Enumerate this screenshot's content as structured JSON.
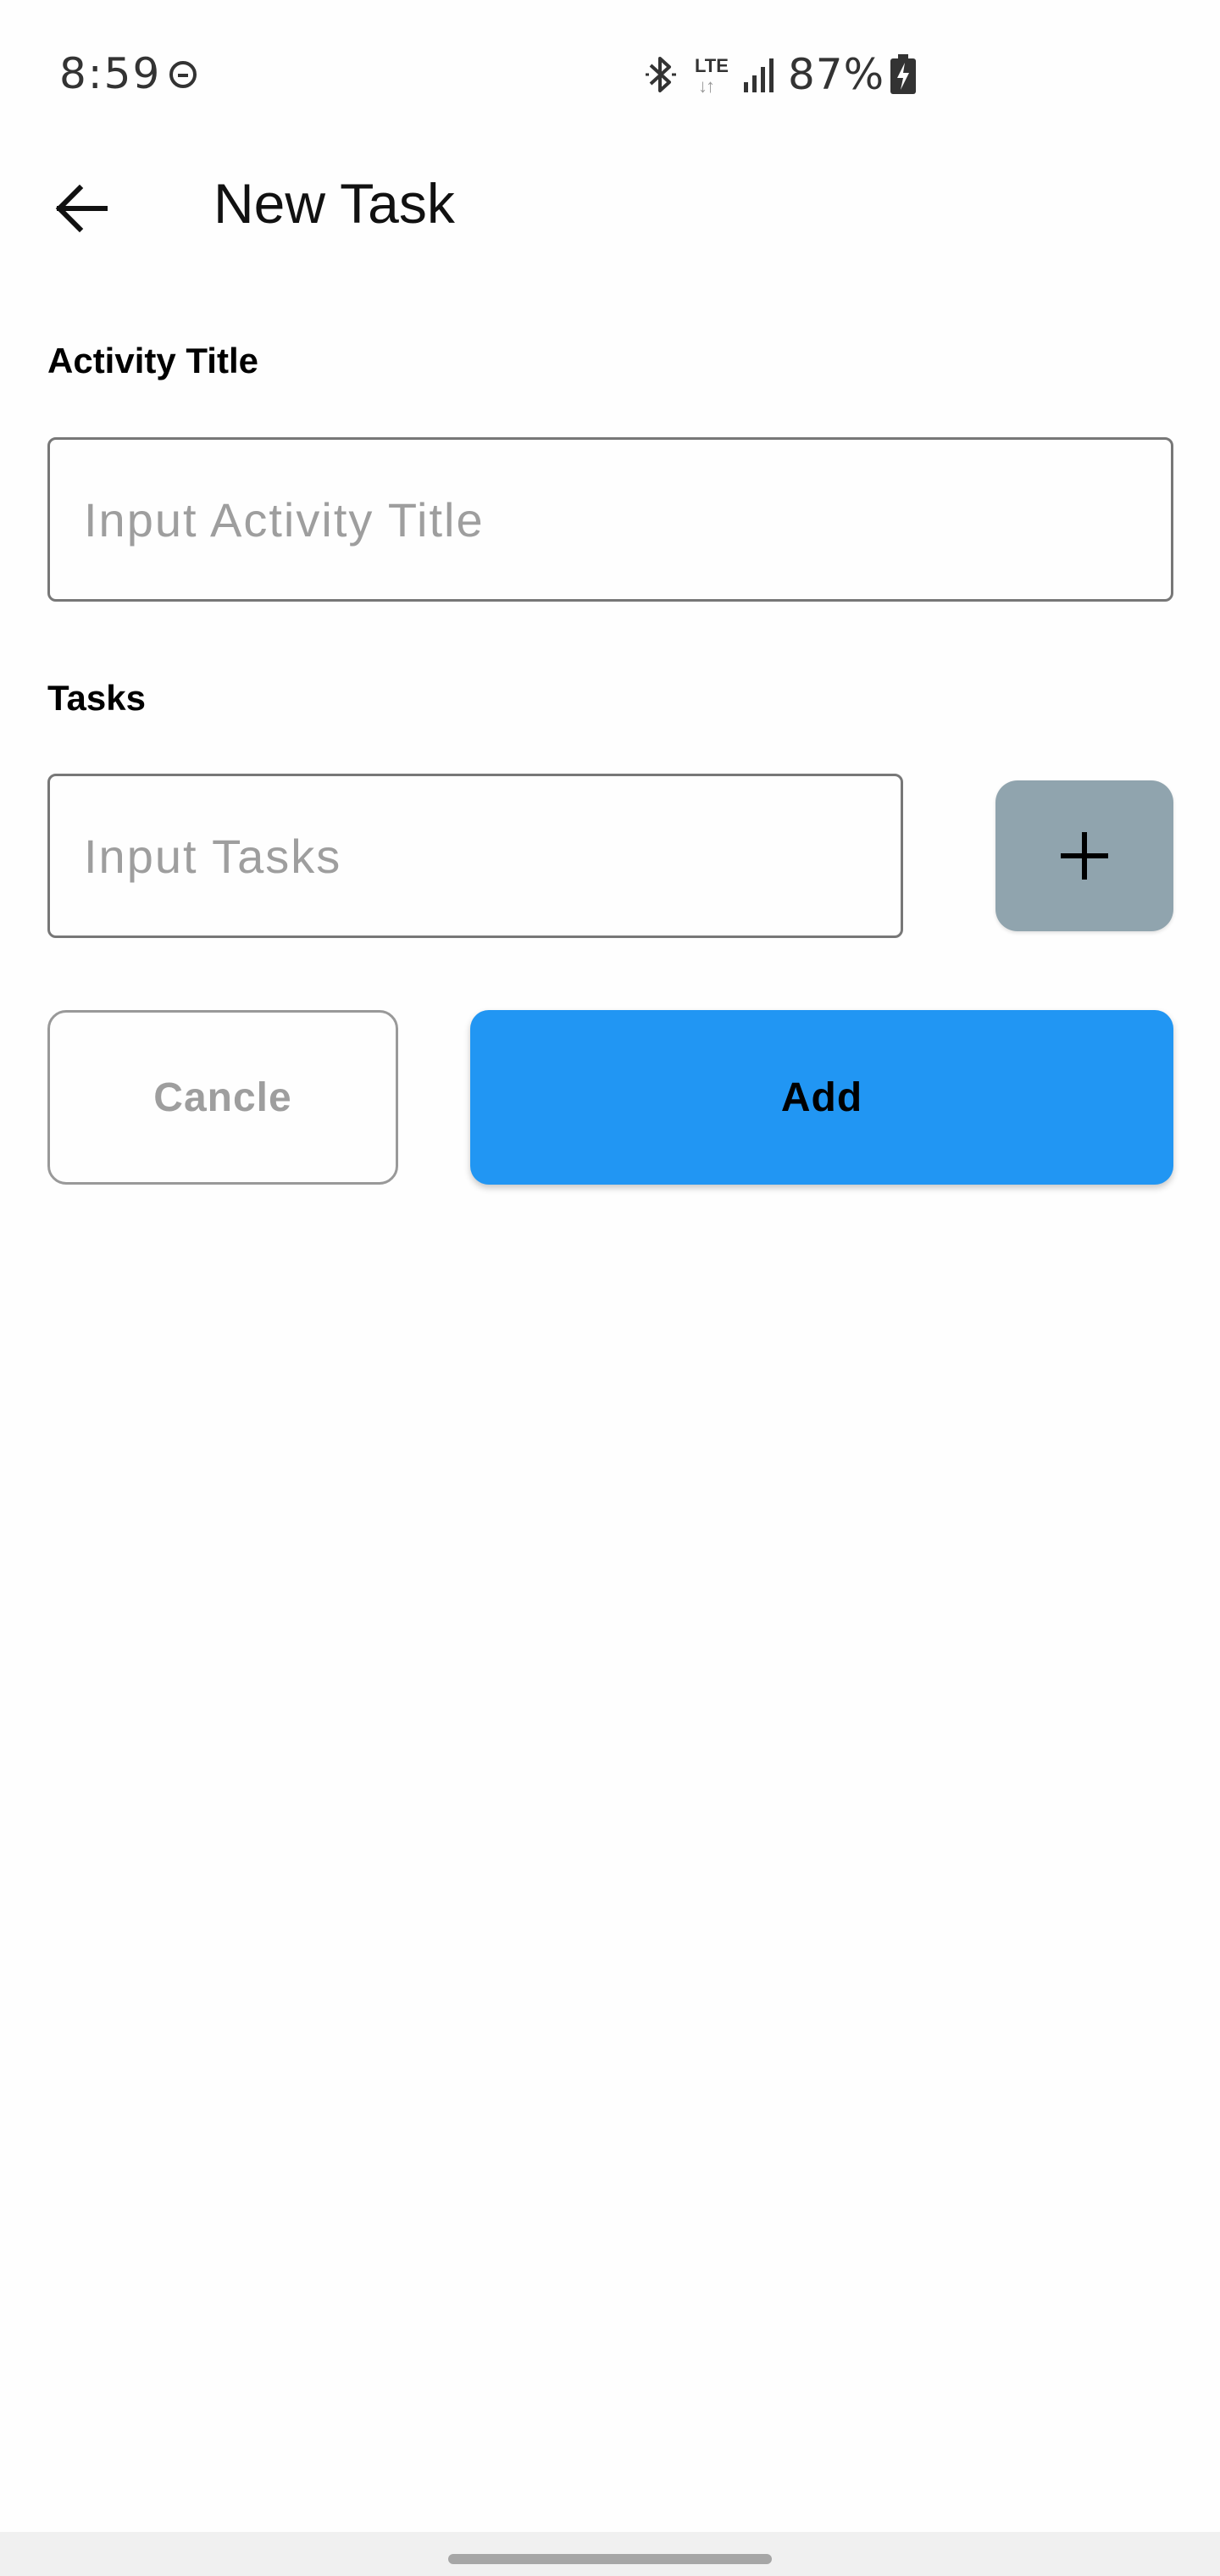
{
  "status_bar": {
    "time": "8:59",
    "network_type": "LTE",
    "network_arrows": "↓↑",
    "battery_percent": "87%",
    "icons": [
      "do-not-disturb-icon",
      "bluetooth-icon",
      "lte-icon",
      "signal-icon",
      "battery-charging-icon"
    ]
  },
  "app_bar": {
    "title": "New Task",
    "back_icon": "arrow-left-icon"
  },
  "form": {
    "activity_title": {
      "label": "Activity Title",
      "placeholder": "Input Activity Title",
      "value": ""
    },
    "tasks": {
      "label": "Tasks",
      "placeholder": "Input Tasks",
      "value": "",
      "add_icon": "plus-icon"
    }
  },
  "actions": {
    "cancel_label": "Cancle",
    "add_label": "Add"
  },
  "colors": {
    "primary": "#2196f3",
    "add_task_button": "#90a4ae",
    "placeholder": "#9e9e9e",
    "background": "#fefefe"
  }
}
